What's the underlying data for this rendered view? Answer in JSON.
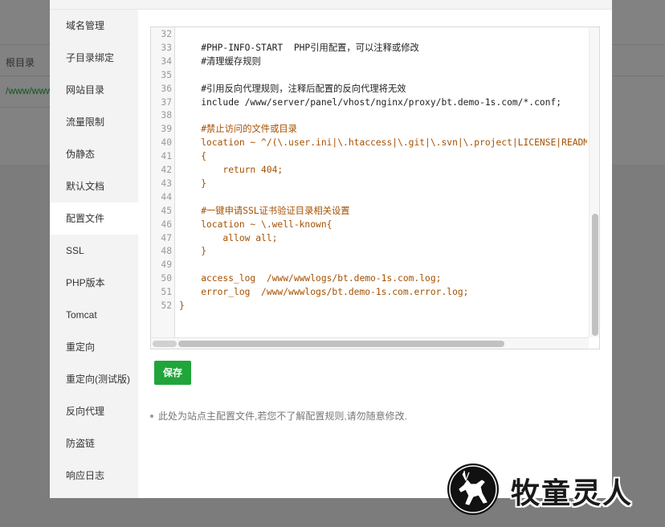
{
  "background": {
    "column_label": "根目录",
    "row_value": "/www/wwwroot"
  },
  "sidebar": {
    "items": [
      {
        "label": "域名管理"
      },
      {
        "label": "子目录绑定"
      },
      {
        "label": "网站目录"
      },
      {
        "label": "流量限制"
      },
      {
        "label": "伪静态"
      },
      {
        "label": "默认文档"
      },
      {
        "label": "配置文件",
        "active": true
      },
      {
        "label": "SSL"
      },
      {
        "label": "PHP版本"
      },
      {
        "label": "Tomcat"
      },
      {
        "label": "重定向"
      },
      {
        "label": "重定向(测试版)"
      },
      {
        "label": "反向代理"
      },
      {
        "label": "防盗链"
      },
      {
        "label": "响应日志"
      }
    ]
  },
  "editor": {
    "lines": [
      {
        "num": "32",
        "text": ""
      },
      {
        "num": "33",
        "text": "    #PHP-INFO-START  PHP引用配置，可以注释或修改"
      },
      {
        "num": "34",
        "text": "    #清理缓存规则"
      },
      {
        "num": "35",
        "text": ""
      },
      {
        "num": "36",
        "text": "    #引用反向代理规则，注释后配置的反向代理将无效"
      },
      {
        "num": "37",
        "text": "    include /www/server/panel/vhost/nginx/proxy/bt.demo-1s.com/*.conf;"
      },
      {
        "num": "38",
        "text": ""
      },
      {
        "num": "39",
        "text": "    #禁止访问的文件或目录",
        "orange": true
      },
      {
        "num": "40",
        "text": "    location ~ ^/(\\.user.ini|\\.htaccess|\\.git|\\.svn|\\.project|LICENSE|README.md)",
        "orange": true
      },
      {
        "num": "41",
        "text": "    {",
        "orange": true
      },
      {
        "num": "42",
        "text": "        return 404;",
        "orange": true
      },
      {
        "num": "43",
        "text": "    }",
        "orange": true
      },
      {
        "num": "44",
        "text": ""
      },
      {
        "num": "45",
        "text": "    #一键申请SSL证书验证目录相关设置",
        "orange": true
      },
      {
        "num": "46",
        "text": "    location ~ \\.well-known{",
        "orange": true
      },
      {
        "num": "47",
        "text": "        allow all;",
        "orange": true
      },
      {
        "num": "48",
        "text": "    }",
        "orange": true
      },
      {
        "num": "49",
        "text": ""
      },
      {
        "num": "50",
        "text": "    access_log  /www/wwwlogs/bt.demo-1s.com.log;",
        "orange": true
      },
      {
        "num": "51",
        "text": "    error_log  /www/wwwlogs/bt.demo-1s.com.error.log;",
        "orange": true
      },
      {
        "num": "52",
        "text": "}",
        "orange": true
      }
    ]
  },
  "save_label": "保存",
  "tip": "此处为站点主配置文件,若您不了解配置规则,请勿随意修改.",
  "watermark": {
    "text": "牧童灵人",
    "icon": "deer-icon"
  },
  "colors": {
    "accent": "#20a53a",
    "code_orange": "#a55000"
  }
}
